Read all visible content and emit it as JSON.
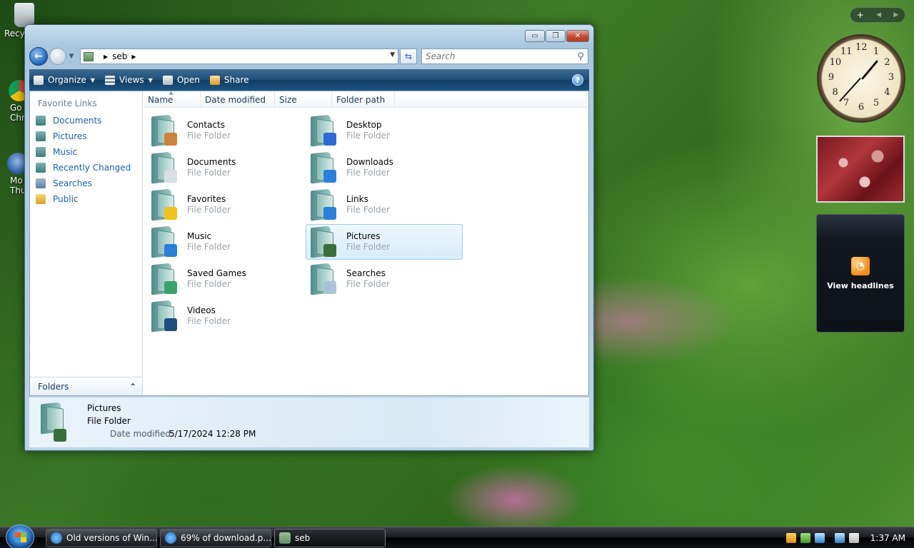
{
  "desktop": {
    "icons": [
      {
        "label": "Recy",
        "icon": "recycle-bin-icon"
      },
      {
        "label": "Go\nChr",
        "icon": "chrome-icon"
      },
      {
        "label": "Mo\nThun",
        "icon": "thunderbird-icon"
      }
    ]
  },
  "window": {
    "controls": {
      "minimize": "▭",
      "maximize": "❐",
      "close": "✕"
    },
    "address": {
      "segment": "seb",
      "dropdown": "▼"
    },
    "search": {
      "placeholder": "Search",
      "icon": "magnifier-icon"
    },
    "toolbar": {
      "organize": "Organize",
      "views": "Views",
      "open": "Open",
      "share": "Share",
      "help": "?"
    },
    "nav": {
      "favorites_heading": "Favorite Links",
      "links": [
        "Documents",
        "Pictures",
        "Music",
        "Recently Changed",
        "Searches",
        "Public"
      ],
      "folders_label": "Folders",
      "folders_toggle": "⌃"
    },
    "columns": [
      "Name",
      "Date modified",
      "Size",
      "Folder path"
    ],
    "items": [
      {
        "name": "Contacts",
        "type": "File Folder",
        "badge": "contacts-badge-icon",
        "color": "#c9833a"
      },
      {
        "name": "Desktop",
        "type": "File Folder",
        "badge": "desktop-badge-icon",
        "color": "#2f6ad3"
      },
      {
        "name": "Documents",
        "type": "File Folder",
        "badge": "documents-badge-icon",
        "color": "#d9dee3"
      },
      {
        "name": "Downloads",
        "type": "File Folder",
        "badge": "downloads-badge-icon",
        "color": "#2a7fd7"
      },
      {
        "name": "Favorites",
        "type": "File Folder",
        "badge": "star-badge-icon",
        "color": "#f2c21c"
      },
      {
        "name": "Links",
        "type": "File Folder",
        "badge": "links-badge-icon",
        "color": "#2a7fd7"
      },
      {
        "name": "Music",
        "type": "File Folder",
        "badge": "music-badge-icon",
        "color": "#2a7fd7"
      },
      {
        "name": "Pictures",
        "type": "File Folder",
        "badge": "pictures-badge-icon",
        "color": "#3a6d3a"
      },
      {
        "name": "Saved Games",
        "type": "File Folder",
        "badge": "saved-games-badge-icon",
        "color": "#3aa36b"
      },
      {
        "name": "Searches",
        "type": "File Folder",
        "badge": "searches-badge-icon",
        "color": "#a9c2d8"
      },
      {
        "name": "Videos",
        "type": "File Folder",
        "badge": "videos-badge-icon",
        "color": "#1f4f7c"
      }
    ],
    "details": {
      "name": "Pictures",
      "type": "File Folder",
      "date_label": "Date modified:",
      "date_value": "5/17/2024 12:28 PM"
    }
  },
  "gadgets": {
    "sidebar_controls": {
      "add": "+",
      "prev": "◀",
      "next": "▶"
    },
    "clock_numbers": [
      "12",
      "1",
      "2",
      "3",
      "4",
      "5",
      "6",
      "7",
      "8",
      "9",
      "10",
      "11"
    ],
    "feed_label": "View headlines"
  },
  "taskbar": {
    "tasks": [
      {
        "label": "Old versions of Win...",
        "icon": "internet-explorer-icon"
      },
      {
        "label": "69% of download.p...",
        "icon": "internet-explorer-icon"
      },
      {
        "label": "seb",
        "icon": "folder-icon"
      }
    ],
    "time": "1:37 AM"
  }
}
